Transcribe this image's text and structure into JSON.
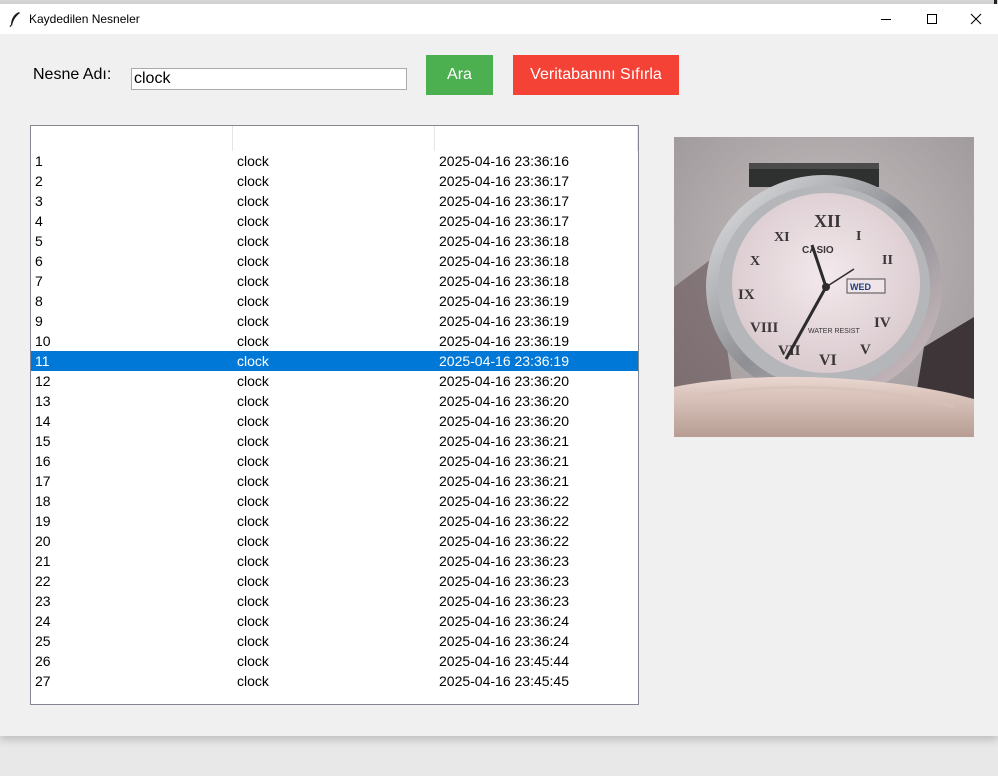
{
  "window": {
    "title": "Kaydedilen Nesneler"
  },
  "search": {
    "label": "Nesne Adı:",
    "value": "clock",
    "search_button": "Ara",
    "reset_button": "Veritabanını Sıfırla"
  },
  "colors": {
    "search_button": "#4caf50",
    "reset_button": "#f44336",
    "selection": "#0078d7"
  },
  "table": {
    "columns": [
      "",
      "",
      ""
    ],
    "selected_index": 10,
    "rows": [
      [
        "1",
        "clock",
        "2025-04-16 23:36:16"
      ],
      [
        "2",
        "clock",
        "2025-04-16 23:36:17"
      ],
      [
        "3",
        "clock",
        "2025-04-16 23:36:17"
      ],
      [
        "4",
        "clock",
        "2025-04-16 23:36:17"
      ],
      [
        "5",
        "clock",
        "2025-04-16 23:36:18"
      ],
      [
        "6",
        "clock",
        "2025-04-16 23:36:18"
      ],
      [
        "7",
        "clock",
        "2025-04-16 23:36:18"
      ],
      [
        "8",
        "clock",
        "2025-04-16 23:36:19"
      ],
      [
        "9",
        "clock",
        "2025-04-16 23:36:19"
      ],
      [
        "10",
        "clock",
        "2025-04-16 23:36:19"
      ],
      [
        "11",
        "clock",
        "2025-04-16 23:36:19"
      ],
      [
        "12",
        "clock",
        "2025-04-16 23:36:20"
      ],
      [
        "13",
        "clock",
        "2025-04-16 23:36:20"
      ],
      [
        "14",
        "clock",
        "2025-04-16 23:36:20"
      ],
      [
        "15",
        "clock",
        "2025-04-16 23:36:21"
      ],
      [
        "16",
        "clock",
        "2025-04-16 23:36:21"
      ],
      [
        "17",
        "clock",
        "2025-04-16 23:36:21"
      ],
      [
        "18",
        "clock",
        "2025-04-16 23:36:22"
      ],
      [
        "19",
        "clock",
        "2025-04-16 23:36:22"
      ],
      [
        "20",
        "clock",
        "2025-04-16 23:36:22"
      ],
      [
        "21",
        "clock",
        "2025-04-16 23:36:23"
      ],
      [
        "22",
        "clock",
        "2025-04-16 23:36:23"
      ],
      [
        "23",
        "clock",
        "2025-04-16 23:36:23"
      ],
      [
        "24",
        "clock",
        "2025-04-16 23:36:24"
      ],
      [
        "25",
        "clock",
        "2025-04-16 23:36:24"
      ],
      [
        "26",
        "clock",
        "2025-04-16 23:45:44"
      ],
      [
        "27",
        "clock",
        "2025-04-16 23:45:45"
      ]
    ]
  },
  "preview": {
    "watch_brand": "CASIO",
    "watch_text": "WATER RESIST",
    "watch_day": "WED"
  }
}
